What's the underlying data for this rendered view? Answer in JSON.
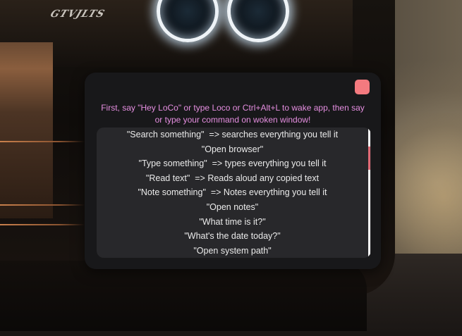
{
  "app": {
    "close_icon": "close-icon",
    "accent_color": "#f47a7f",
    "instructions": "First, say \"Hey LoCo\" or type Loco or Ctrl+Alt+L to wake app, then say or type your command on woken window!"
  },
  "wallpaper": {
    "badge_text": "GTVJLTS"
  },
  "commands": [
    {
      "text": "\"Search something\"  => searches everything you tell it"
    },
    {
      "text": "\"Open browser\""
    },
    {
      "text": "\"Type something\"  => types everything you tell it"
    },
    {
      "text": "\"Read text\"  => Reads aloud any copied text"
    },
    {
      "text": "\"Note something\"  => Notes everything you tell it"
    },
    {
      "text": "\"Open notes\""
    },
    {
      "text": "\"What time is it?\""
    },
    {
      "text": "\"What's the date today?\""
    },
    {
      "text": "\"Open system path\""
    }
  ]
}
